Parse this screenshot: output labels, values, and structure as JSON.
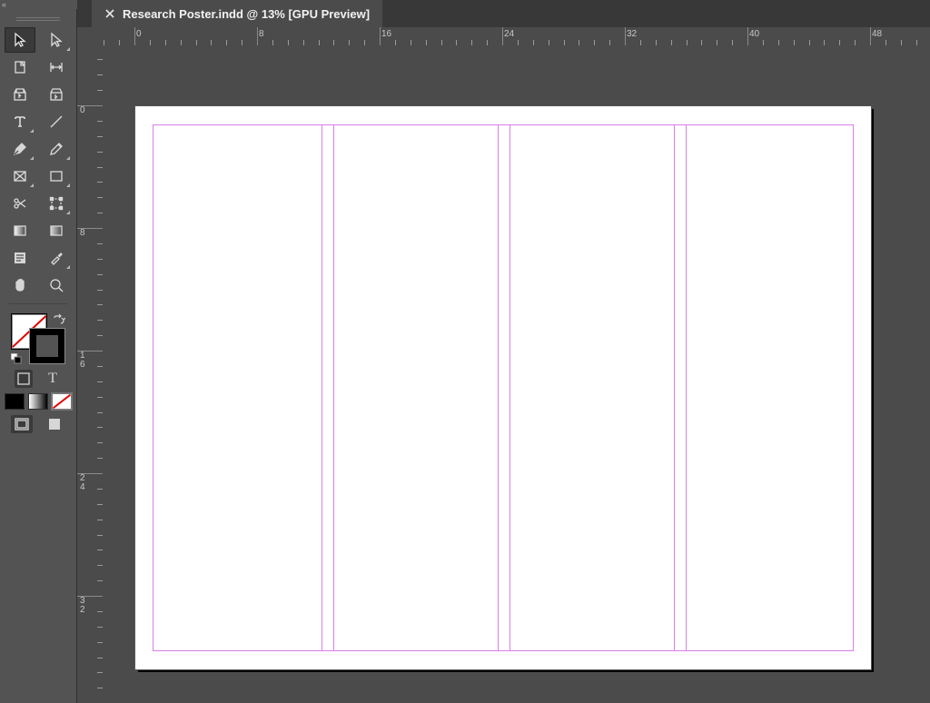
{
  "document": {
    "tab_title": "Research Poster.indd @ 13% [GPU Preview]"
  },
  "ruler": {
    "h_labels": [
      "0",
      "8",
      "16",
      "24",
      "32",
      "40",
      "48"
    ],
    "v_labels": [
      "0",
      "8",
      "16",
      "24",
      "32"
    ]
  },
  "tools": {
    "row1": [
      "selection-tool",
      "direct-selection-tool"
    ],
    "row2": [
      "page-tool",
      "gap-tool"
    ],
    "row3": [
      "content-collector-tool",
      "content-placer-tool"
    ],
    "row4": [
      "type-tool",
      "line-tool"
    ],
    "row5": [
      "pen-tool",
      "pencil-tool"
    ],
    "row6": [
      "rectangle-frame-tool",
      "rectangle-tool"
    ],
    "row7": [
      "scissors-tool",
      "free-transform-tool"
    ],
    "row8": [
      "gradient-swatch-tool",
      "gradient-feather-tool"
    ],
    "row9": [
      "note-tool",
      "eyedropper-tool"
    ],
    "row10": [
      "hand-tool",
      "zoom-tool"
    ],
    "selected": "selection-tool"
  },
  "format_affects": {
    "container_selected": true
  },
  "color_mode": {
    "selected": "none"
  },
  "view_mode": {
    "selected": "normal"
  }
}
